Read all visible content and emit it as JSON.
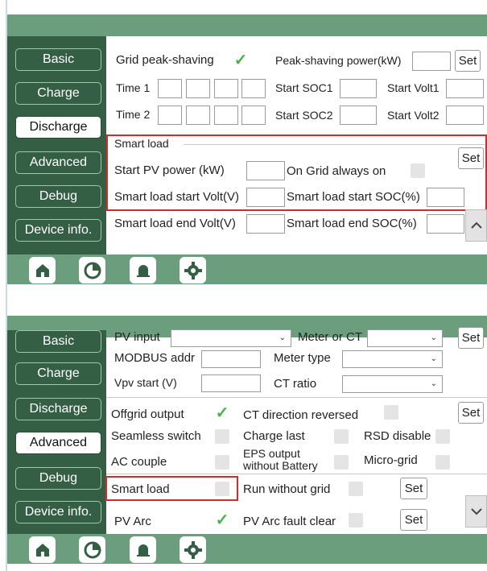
{
  "screen1": {
    "nav": [
      "Basic",
      "Charge",
      "Discharge",
      "Advanced",
      "Debug",
      "Device info."
    ],
    "active": "Discharge",
    "grid_peak_shaving": "Grid peak-shaving",
    "peak_shaving_power": "Peak-shaving power(kW)",
    "set": "Set",
    "time1": "Time 1",
    "time2": "Time 2",
    "start_soc1": "Start SOC1",
    "start_soc2": "Start SOC2",
    "start_volt1": "Start Volt1",
    "start_volt2": "Start Volt2",
    "smart_load_title": "Smart load",
    "start_pv_power": "Start PV power (kW)",
    "on_grid_always_on": "On Grid always on",
    "smart_load_start_volt": "Smart load start Volt(V)",
    "smart_load_start_soc": "Smart load start SOC(%)",
    "smart_load_end_volt": "Smart load end Volt(V)",
    "smart_load_end_soc": "Smart load end SOC(%)",
    "set2": "Set"
  },
  "screen2": {
    "nav": [
      "Basic",
      "Charge",
      "Discharge",
      "Advanced",
      "Debug",
      "Device info."
    ],
    "active": "Advanced",
    "pv_input": "PV input",
    "meter_or_ct": "Meter or CT",
    "modbus_addr": "MODBUS addr",
    "meter_type": "Meter type",
    "vpv_start": "Vpv start (V)",
    "ct_ratio": "CT ratio",
    "set": "Set",
    "offgrid_output": "Offgrid output",
    "ct_direction_reversed": "CT direction reversed",
    "seamless_switch": "Seamless switch",
    "charge_last": "Charge last",
    "rsd_disable": "RSD disable",
    "ac_couple": "AC couple",
    "eps_output_line1": "EPS output",
    "eps_output_line2": "without Battery",
    "micro_grid": "Micro-grid",
    "smart_load": "Smart load",
    "run_without_grid": "Run without grid",
    "pv_arc": "PV Arc",
    "pv_arc_fault_clear": "PV Arc fault clear"
  },
  "icons": [
    "home-icon",
    "pie-chart-icon",
    "alarm-bell-icon",
    "settings-gear-icon"
  ],
  "colors": {
    "bar": "#6a9e7c",
    "sidebar": "#355f45",
    "highlight": "#d92828",
    "check": "#4cb24c"
  }
}
